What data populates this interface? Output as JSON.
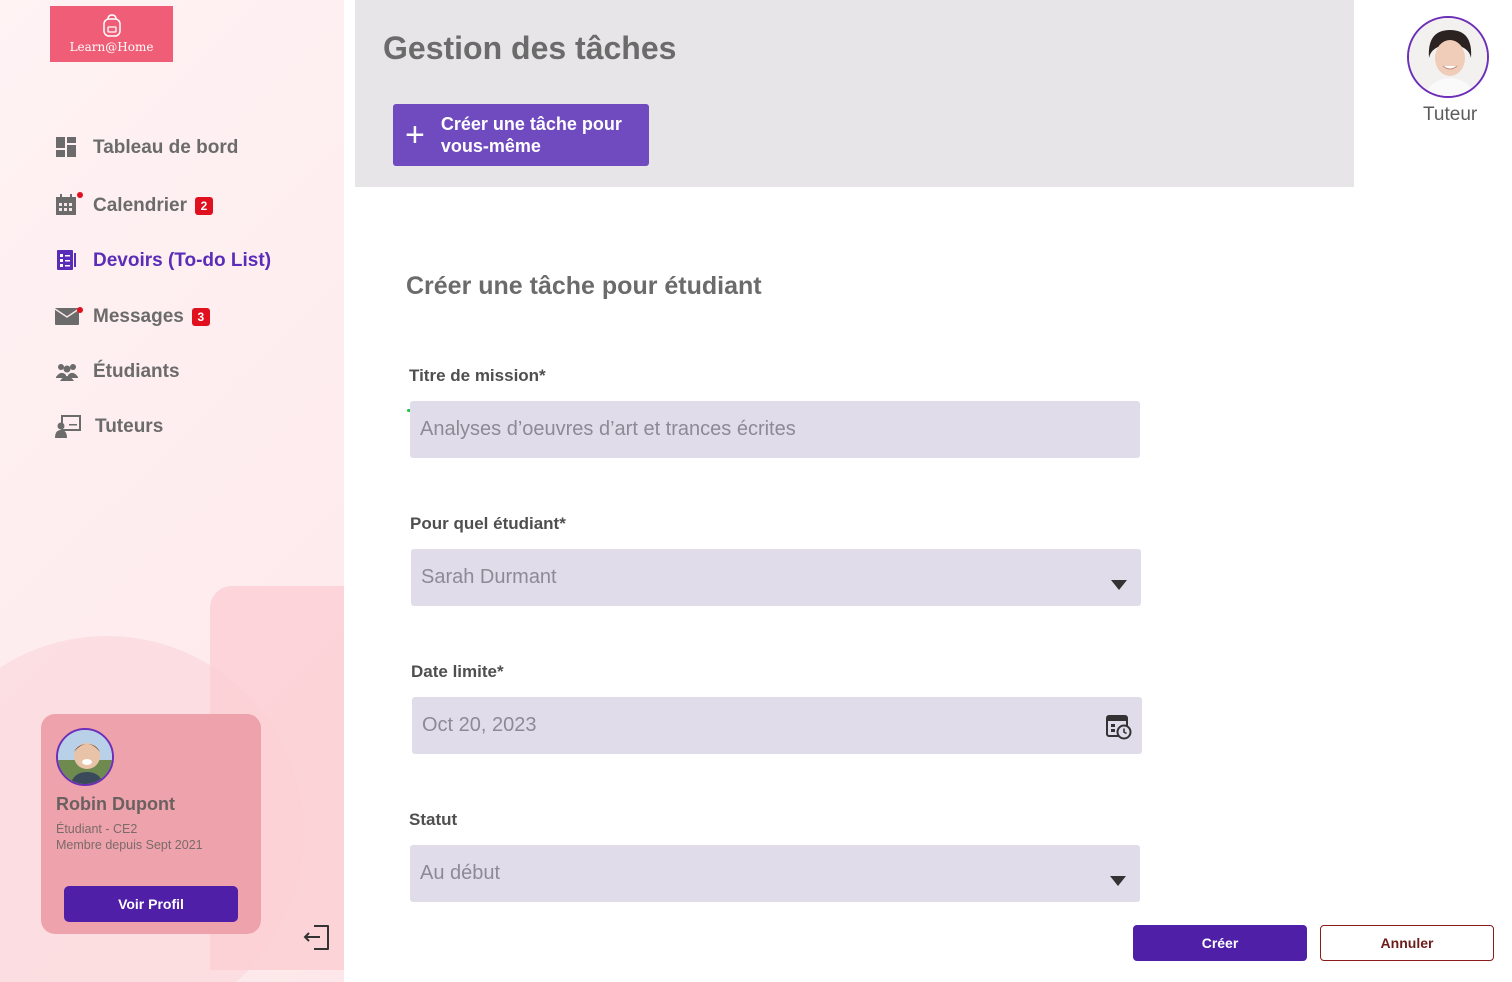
{
  "brand": {
    "name": "Learn@Home",
    "color": "#f05d76"
  },
  "sidebar": {
    "items": [
      {
        "label": "Tableau de bord",
        "icon": "dashboard-icon",
        "badge": null,
        "active": false
      },
      {
        "label": "Calendrier",
        "icon": "calendar-icon",
        "badge": "2",
        "active": false
      },
      {
        "label": "Devoirs (To-do List)",
        "icon": "todo-list-icon",
        "badge": null,
        "active": true
      },
      {
        "label": "Messages",
        "icon": "mail-icon",
        "badge": "3",
        "active": false
      },
      {
        "label": "Étudiants",
        "icon": "students-icon",
        "badge": null,
        "active": false
      },
      {
        "label": "Tuteurs",
        "icon": "tutor-icon",
        "badge": null,
        "active": false
      }
    ],
    "profile": {
      "name": "Robin Dupont",
      "role": "Étudiant - CE2",
      "member_since": "Membre depuis Sept 2021",
      "button": "Voir Profil"
    }
  },
  "header": {
    "title": "Gestion des tâches",
    "create_self_button": "Créer une tâche pour vous-même"
  },
  "user": {
    "role_label": "Tuteur"
  },
  "form": {
    "title": "Créer une tâche pour étudiant",
    "mission_title": {
      "label": "Titre de mission*",
      "value": "Analyses d’oeuvres d’art et trances écrites"
    },
    "student": {
      "label": "Pour quel étudiant*",
      "value": "Sarah Durmant"
    },
    "deadline": {
      "label": "Date limite*",
      "value": "Oct 20, 2023"
    },
    "status": {
      "label": "Statut",
      "value": "Au début"
    },
    "create_button": "Créer",
    "cancel_button": "Annuler"
  },
  "colors": {
    "accent": "#5a2db8",
    "button_primary": "#4f1fa8",
    "field_bg": "#e1dcea",
    "badge": "#e0101e"
  }
}
